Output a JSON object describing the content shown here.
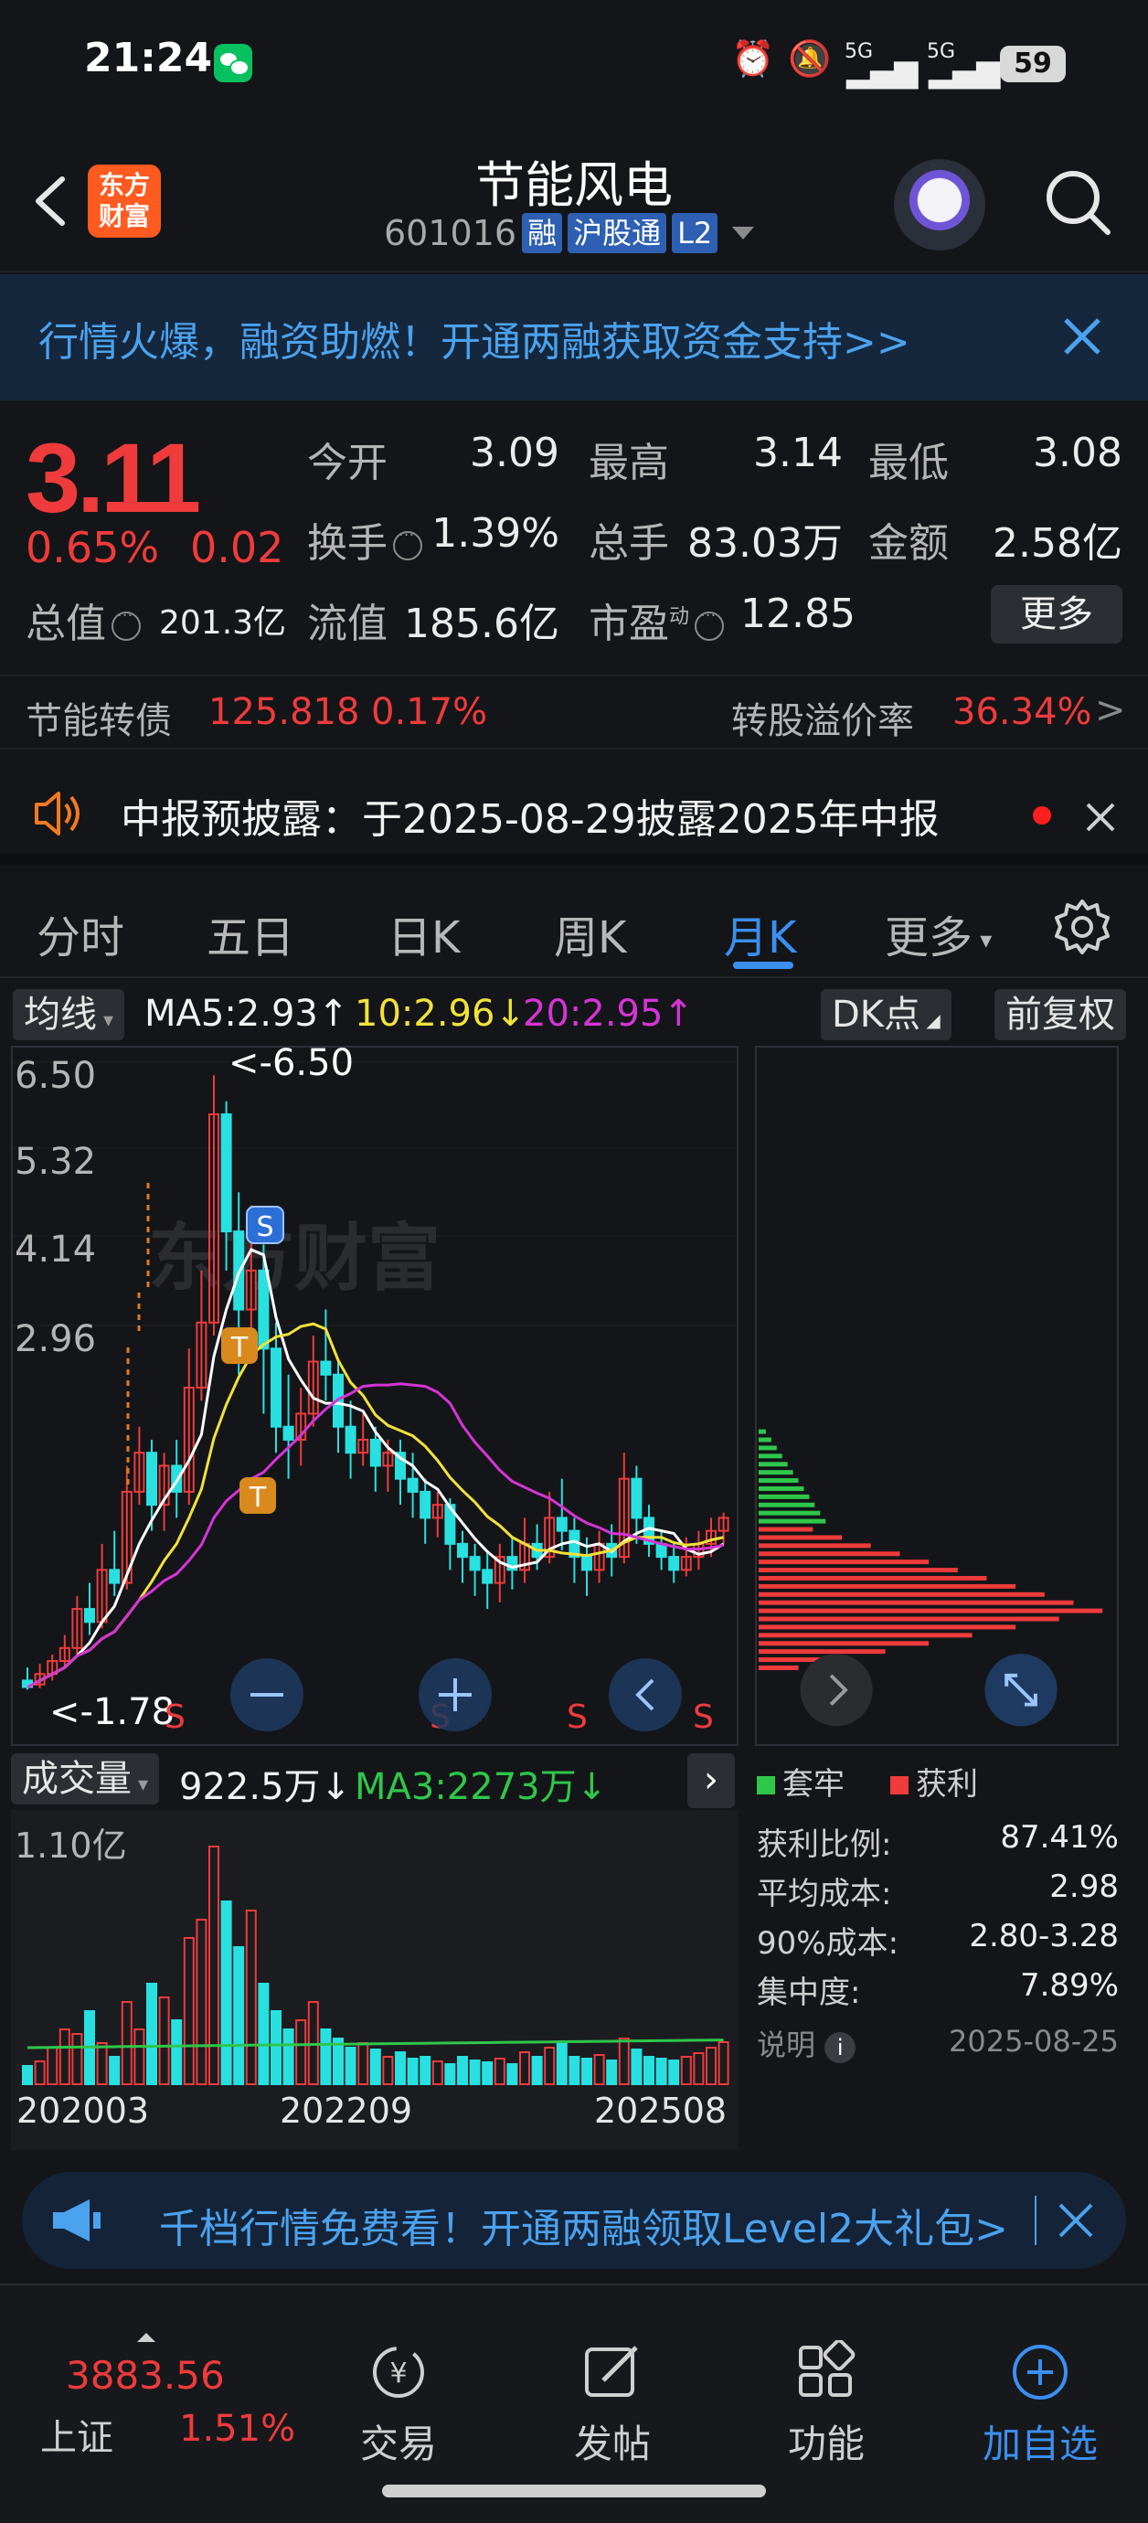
{
  "status_bar": {
    "time": "21:24",
    "signal_1": "5G",
    "signal_2": "5G",
    "battery": "59"
  },
  "header": {
    "logo_line1": "东方",
    "logo_line2": "财富",
    "stock_name": "节能风电",
    "stock_code": "601016",
    "tags": [
      "融",
      "沪股通",
      "L2"
    ]
  },
  "top_banner": {
    "text": "行情火爆，融资助燃！开通两融获取资金支持>>"
  },
  "quote": {
    "price": "3.11",
    "change_pct": "0.65%",
    "change_amt": "0.02",
    "open_label": "今开",
    "open": "3.09",
    "high_label": "最高",
    "high": "3.14",
    "low_label": "最低",
    "low": "3.08",
    "turnover_label": "换手",
    "turnover": "1.39%",
    "volume_label": "总手",
    "volume": "83.03万",
    "amount_label": "金额",
    "amount": "2.58亿",
    "mcap_label": "总值",
    "mcap": "201.3亿",
    "float_label": "流值",
    "float_cap": "185.6亿",
    "pe_label": "市盈",
    "pe_sup": "动",
    "pe": "12.85",
    "more_button": "更多"
  },
  "bond": {
    "name": "节能转债",
    "price": "125.818",
    "change": "0.17%",
    "premium_label": "转股溢价率",
    "premium": "36.34%",
    "arrow": ">"
  },
  "notice": {
    "text": "中报预披露：于2025-08-29披露2025年中报"
  },
  "tabs": [
    "分时",
    "五日",
    "日K",
    "周K",
    "月K",
    "更多"
  ],
  "ma_bar": {
    "type_chip": "均线",
    "ma5": "MA5:2.93↑",
    "ma10": "10:2.96↓",
    "ma20": "20:2.95↑",
    "dk_chip": "DK点",
    "adjust_chip": "前复权"
  },
  "kchart": {
    "y_ticks": [
      "6.50",
      "5.32",
      "4.14",
      "2.96"
    ],
    "max_marker": "<-6.50",
    "min_marker": "<-1.78",
    "watermark": "东方财富",
    "signal_letters": [
      "S",
      "S",
      "S",
      "S"
    ],
    "markers": [
      "S",
      "T",
      "T"
    ]
  },
  "volume": {
    "chip": "成交量",
    "value": "922.5万↓",
    "ma3": "MA3:2273万↓",
    "y_tick": "1.10亿",
    "x_ticks": [
      "202003",
      "202209",
      "202508"
    ]
  },
  "chip_dist": {
    "legend_trapped": "套牢",
    "legend_profit": "获利",
    "rows": [
      {
        "label": "获利比例:",
        "value": "87.41%"
      },
      {
        "label": "平均成本:",
        "value": "2.98"
      },
      {
        "label": "90%成本:",
        "value": "2.80-3.28"
      },
      {
        "label": "集中度:",
        "value": "7.89%"
      }
    ],
    "note_label": "说明",
    "date": "2025-08-25"
  },
  "promo": {
    "text": "千档行情免费看！开通两融领取Level2大礼包>"
  },
  "bottom_nav": {
    "index_value": "3883.56",
    "index_name": "上证",
    "index_change": "1.51%",
    "items": [
      "交易",
      "发帖",
      "功能",
      "加自选"
    ]
  },
  "colors": {
    "up": "#ef3b3b",
    "down": "#2fc74a",
    "accent": "#3b8ff0",
    "candle_up": "#ef3b3b",
    "candle_down": "#28e0e0",
    "ma5": "#ffffff",
    "ma10": "#f2e23a",
    "ma20": "#d634d6"
  }
}
